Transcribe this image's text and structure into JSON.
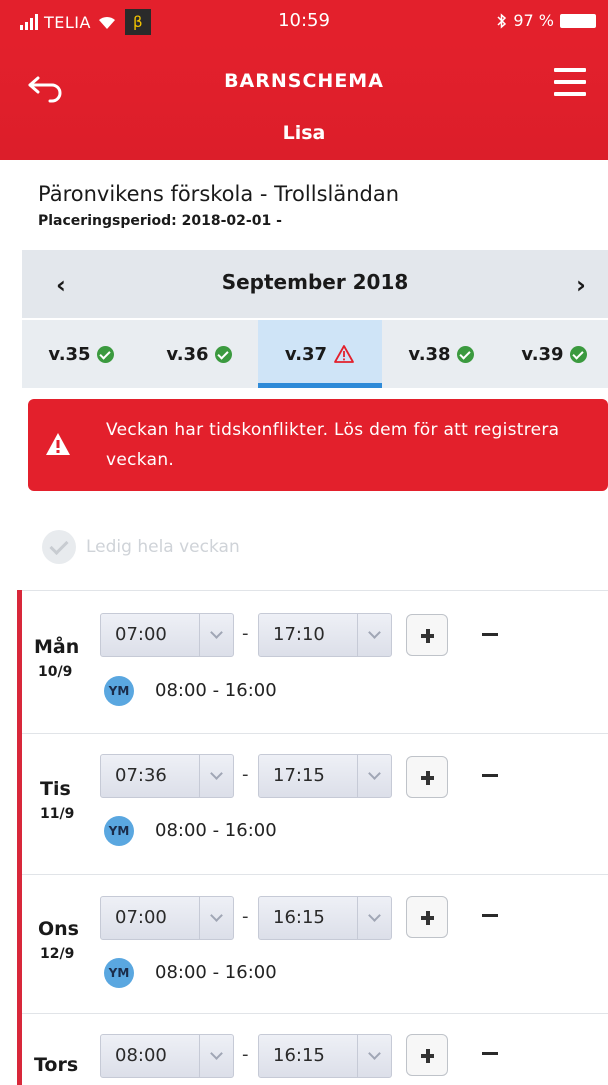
{
  "status_bar": {
    "carrier": "TELIA",
    "beta": "β",
    "time": "10:59",
    "battery": "97 %"
  },
  "header": {
    "title": "BARNSCHEMA",
    "child": "Lisa"
  },
  "info": {
    "school": "Päronvikens förskola - Trollsländan",
    "period": "Placeringsperiod: 2018-02-01 -"
  },
  "month_nav": {
    "label": "September 2018",
    "prev": "‹",
    "next": "›"
  },
  "weeks": [
    {
      "label": "v.35",
      "status": "ok"
    },
    {
      "label": "v.36",
      "status": "ok"
    },
    {
      "label": "v.37",
      "status": "warning",
      "active": true
    },
    {
      "label": "v.38",
      "status": "ok"
    },
    {
      "label": "v.39",
      "status": "ok"
    }
  ],
  "alert": {
    "text": "Veckan har tidskonflikter. Lös dem för att registrera veckan."
  },
  "free_week": {
    "label": "Ledig hela veckan"
  },
  "days": [
    {
      "name": "Mån",
      "date": "10/9",
      "from": "07:00",
      "to": "17:10",
      "avatar": "YM",
      "schedule": "08:00 - 16:00"
    },
    {
      "name": "Tis",
      "date": "11/9",
      "from": "07:36",
      "to": "17:15",
      "avatar": "YM",
      "schedule": "08:00 - 16:00"
    },
    {
      "name": "Ons",
      "date": "12/9",
      "from": "07:00",
      "to": "16:15",
      "avatar": "YM",
      "schedule": "08:00 - 16:00"
    },
    {
      "name": "Tors",
      "date": "",
      "from": "08:00",
      "to": "16:15",
      "avatar": "",
      "schedule": ""
    }
  ],
  "separator": "-",
  "colors": {
    "brand_red": "#e3202c",
    "ok_green": "#3b9a3f",
    "active_blue": "#2e8ad8",
    "avatar_blue": "#5aa7e0"
  },
  "icons": {
    "back": "back-arrow-icon",
    "menu": "hamburger-menu-icon",
    "ok": "check-circle-icon",
    "warning": "warning-triangle-icon",
    "add": "plus-icon",
    "remove": "minus-icon"
  }
}
